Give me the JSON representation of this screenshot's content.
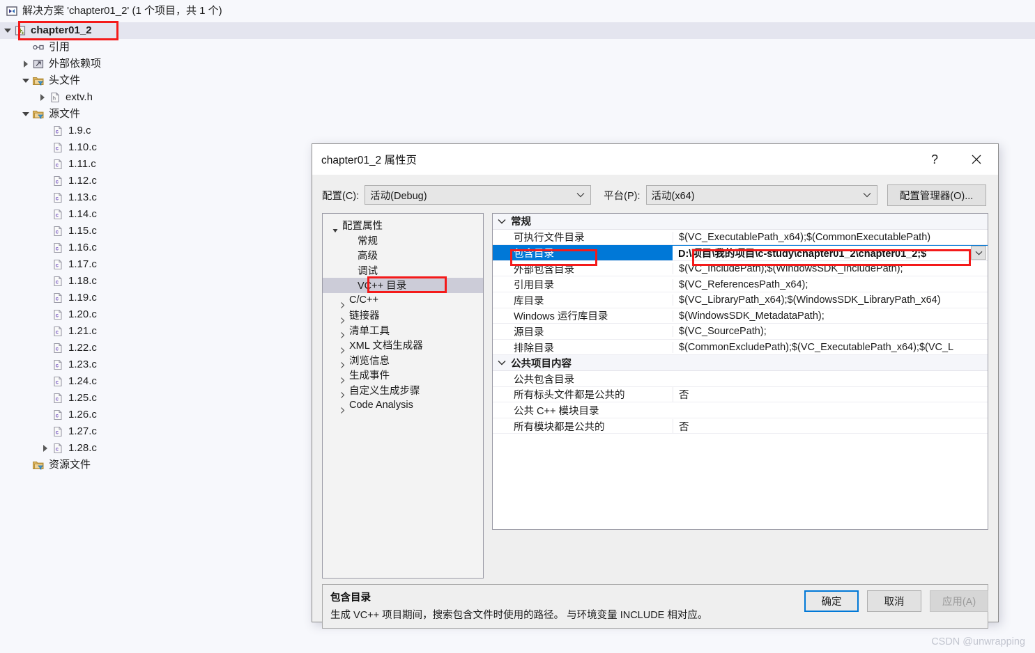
{
  "solution_explorer": {
    "header": "解决方案 'chapter01_2' (1 个项目，共 1 个)",
    "items": [
      {
        "label": "chapter01_2",
        "icon": "cpp-project-icon",
        "indent": 22,
        "expander": "open",
        "bold": true,
        "selected": true
      },
      {
        "label": "引用",
        "icon": "references-icon",
        "indent": 48,
        "expander": "none",
        "bold": false,
        "selected": false
      },
      {
        "label": "外部依赖项",
        "icon": "external-deps-icon",
        "indent": 48,
        "expander": "closed",
        "bold": false,
        "selected": false
      },
      {
        "label": "头文件",
        "icon": "filter-folder-icon",
        "indent": 48,
        "expander": "open",
        "bold": false,
        "selected": false
      },
      {
        "label": "extv.h",
        "icon": "header-file-icon",
        "indent": 72,
        "expander": "closed",
        "bold": false,
        "selected": false
      },
      {
        "label": "源文件",
        "icon": "filter-folder-icon",
        "indent": 48,
        "expander": "open",
        "bold": false,
        "selected": false
      },
      {
        "label": "1.9.c",
        "icon": "c-file-icon",
        "indent": 76,
        "expander": "none",
        "bold": false,
        "selected": false
      },
      {
        "label": "1.10.c",
        "icon": "c-file-icon",
        "indent": 76,
        "expander": "none",
        "bold": false,
        "selected": false
      },
      {
        "label": "1.11.c",
        "icon": "c-file-icon",
        "indent": 76,
        "expander": "none",
        "bold": false,
        "selected": false
      },
      {
        "label": "1.12.c",
        "icon": "c-file-icon",
        "indent": 76,
        "expander": "none",
        "bold": false,
        "selected": false
      },
      {
        "label": "1.13.c",
        "icon": "c-file-icon",
        "indent": 76,
        "expander": "none",
        "bold": false,
        "selected": false
      },
      {
        "label": "1.14.c",
        "icon": "c-file-icon",
        "indent": 76,
        "expander": "none",
        "bold": false,
        "selected": false
      },
      {
        "label": "1.15.c",
        "icon": "c-file-icon",
        "indent": 76,
        "expander": "none",
        "bold": false,
        "selected": false
      },
      {
        "label": "1.16.c",
        "icon": "c-file-icon",
        "indent": 76,
        "expander": "none",
        "bold": false,
        "selected": false
      },
      {
        "label": "1.17.c",
        "icon": "c-file-icon",
        "indent": 76,
        "expander": "none",
        "bold": false,
        "selected": false
      },
      {
        "label": "1.18.c",
        "icon": "c-file-icon",
        "indent": 76,
        "expander": "none",
        "bold": false,
        "selected": false
      },
      {
        "label": "1.19.c",
        "icon": "c-file-icon",
        "indent": 76,
        "expander": "none",
        "bold": false,
        "selected": false
      },
      {
        "label": "1.20.c",
        "icon": "c-file-icon",
        "indent": 76,
        "expander": "none",
        "bold": false,
        "selected": false
      },
      {
        "label": "1.21.c",
        "icon": "c-file-icon",
        "indent": 76,
        "expander": "none",
        "bold": false,
        "selected": false
      },
      {
        "label": "1.22.c",
        "icon": "c-file-icon",
        "indent": 76,
        "expander": "none",
        "bold": false,
        "selected": false
      },
      {
        "label": "1.23.c",
        "icon": "c-file-icon",
        "indent": 76,
        "expander": "none",
        "bold": false,
        "selected": false
      },
      {
        "label": "1.24.c",
        "icon": "c-file-icon",
        "indent": 76,
        "expander": "none",
        "bold": false,
        "selected": false
      },
      {
        "label": "1.25.c",
        "icon": "c-file-icon",
        "indent": 76,
        "expander": "none",
        "bold": false,
        "selected": false
      },
      {
        "label": "1.26.c",
        "icon": "c-file-icon",
        "indent": 76,
        "expander": "none",
        "bold": false,
        "selected": false
      },
      {
        "label": "1.27.c",
        "icon": "c-file-icon",
        "indent": 76,
        "expander": "none",
        "bold": false,
        "selected": false
      },
      {
        "label": "1.28.c",
        "icon": "c-file-icon",
        "indent": 76,
        "expander": "closed",
        "bold": false,
        "selected": false
      },
      {
        "label": "资源文件",
        "icon": "filter-folder-icon",
        "indent": 48,
        "expander": "none",
        "bold": false,
        "selected": false
      }
    ]
  },
  "dialog": {
    "title": "chapter01_2 属性页",
    "help_glyph": "?",
    "close_glyph": "✕",
    "config_label": "配置(C):",
    "config_value": "活动(Debug)",
    "platform_label": "平台(P):",
    "platform_value": "活动(x64)",
    "config_manager_label": "配置管理器(O)...",
    "nav": [
      {
        "label": "配置属性",
        "indent": 6,
        "expander": "open",
        "selected": false
      },
      {
        "label": "常规",
        "indent": 28,
        "expander": "none",
        "selected": false
      },
      {
        "label": "高级",
        "indent": 28,
        "expander": "none",
        "selected": false
      },
      {
        "label": "调试",
        "indent": 28,
        "expander": "none",
        "selected": false
      },
      {
        "label": "VC++ 目录",
        "indent": 28,
        "expander": "none",
        "selected": true
      },
      {
        "label": "C/C++",
        "indent": 16,
        "expander": "closed",
        "selected": false
      },
      {
        "label": "链接器",
        "indent": 16,
        "expander": "closed",
        "selected": false
      },
      {
        "label": "清单工具",
        "indent": 16,
        "expander": "closed",
        "selected": false
      },
      {
        "label": "XML 文档生成器",
        "indent": 16,
        "expander": "closed",
        "selected": false
      },
      {
        "label": "浏览信息",
        "indent": 16,
        "expander": "closed",
        "selected": false
      },
      {
        "label": "生成事件",
        "indent": 16,
        "expander": "closed",
        "selected": false
      },
      {
        "label": "自定义生成步骤",
        "indent": 16,
        "expander": "closed",
        "selected": false
      },
      {
        "label": "Code Analysis",
        "indent": 16,
        "expander": "closed",
        "selected": false
      }
    ],
    "grid": [
      {
        "kind": "category",
        "name": "常规"
      },
      {
        "kind": "prop",
        "name": "可执行文件目录",
        "value": "$(VC_ExecutablePath_x64);$(CommonExecutablePath)"
      },
      {
        "kind": "prop",
        "name": "包含目录",
        "value": "D:\\项目\\我的项目\\c-study\\chapter01_2\\chapter01_2;$",
        "selected": true,
        "has_dropdown": true
      },
      {
        "kind": "prop",
        "name": "外部包含目录",
        "value": "$(VC_IncludePath);$(WindowsSDK_IncludePath);"
      },
      {
        "kind": "prop",
        "name": "引用目录",
        "value": "$(VC_ReferencesPath_x64);"
      },
      {
        "kind": "prop",
        "name": "库目录",
        "value": "$(VC_LibraryPath_x64);$(WindowsSDK_LibraryPath_x64)"
      },
      {
        "kind": "prop",
        "name": "Windows 运行库目录",
        "value": "$(WindowsSDK_MetadataPath);"
      },
      {
        "kind": "prop",
        "name": "源目录",
        "value": "$(VC_SourcePath);"
      },
      {
        "kind": "prop",
        "name": "排除目录",
        "value": "$(CommonExcludePath);$(VC_ExecutablePath_x64);$(VC_L"
      },
      {
        "kind": "category",
        "name": "公共项目内容"
      },
      {
        "kind": "prop",
        "name": "公共包含目录",
        "value": ""
      },
      {
        "kind": "prop",
        "name": "所有标头文件都是公共的",
        "value": "否"
      },
      {
        "kind": "prop",
        "name": "公共 C++ 模块目录",
        "value": ""
      },
      {
        "kind": "prop",
        "name": "所有模块都是公共的",
        "value": "否"
      }
    ],
    "description": {
      "title": "包含目录",
      "text": "生成 VC++ 项目期间，搜索包含文件时使用的路径。 与环境变量 INCLUDE 相对应。"
    },
    "footer": {
      "ok": "确定",
      "cancel": "取消",
      "apply": "应用(A)"
    }
  },
  "watermark": "CSDN @unwrapping",
  "colors": {
    "selection_blue": "#0078d7",
    "annotation_red": "#f41a1a",
    "tree_selection": "#e4e5ef",
    "nav_selection": "#ccccd8",
    "page_bg": "#f7f8fc"
  }
}
